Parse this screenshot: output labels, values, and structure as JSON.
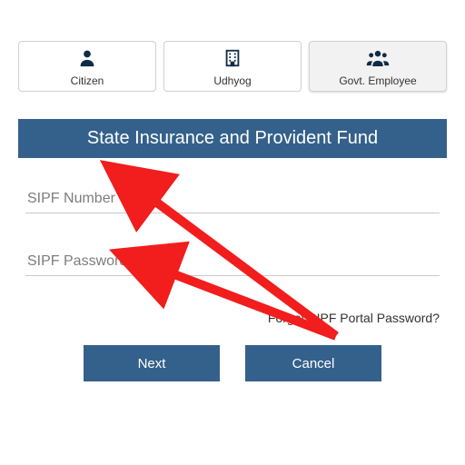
{
  "tabs": {
    "citizen": "Citizen",
    "udhyog": "Udhyog",
    "govt": "Govt. Employee"
  },
  "header": {
    "title": "State Insurance and Provident Fund"
  },
  "fields": {
    "sipf_number_placeholder": "SIPF Number",
    "sipf_password_placeholder": "SIPF Password"
  },
  "links": {
    "forgot": "Forgot SIPF Portal Password?"
  },
  "buttons": {
    "next": "Next",
    "cancel": "Cancel"
  },
  "colors": {
    "primary": "#34618b",
    "icon": "#0f2b46",
    "arrow": "#f21d1d"
  }
}
